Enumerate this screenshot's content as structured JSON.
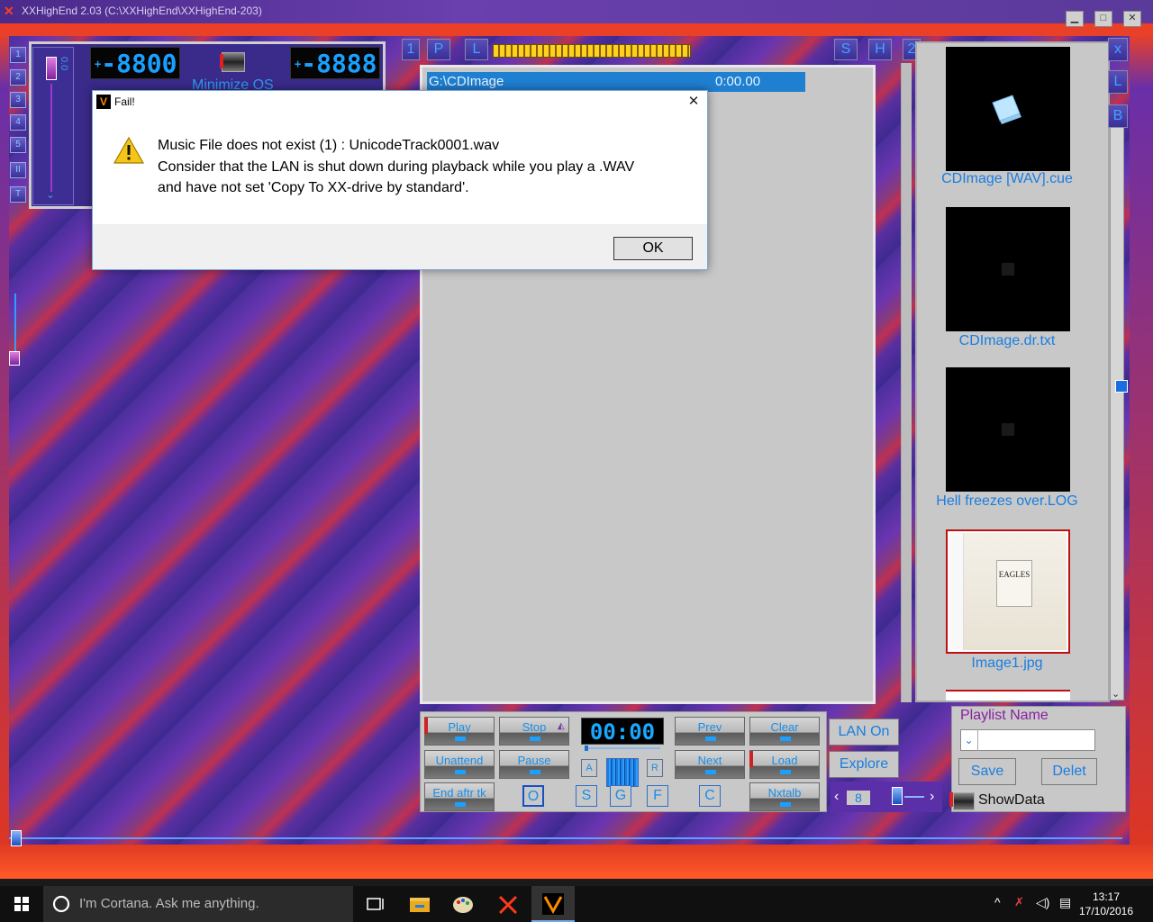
{
  "window": {
    "title": "XXHighEnd 2.03 (C:\\XXHighEnd\\XXHighEnd-203)"
  },
  "left_panel": {
    "number_buttons": [
      "1",
      "2",
      "3",
      "4",
      "5",
      "II",
      "T"
    ],
    "volume_lcd": {
      "sign": "+",
      "digits": "-8800"
    },
    "second_lcd": {
      "sign": "+",
      "digits": "-8888"
    },
    "minimize_os_label": "Minimize OS",
    "vol_axis_label": "0.0"
  },
  "top_tabs": {
    "one": "1",
    "p": "P",
    "l": "L",
    "s": "S",
    "h": "H",
    "two": "2"
  },
  "playlist": {
    "rows": [
      {
        "path": "G:\\CDImage",
        "time": "0:00.00"
      }
    ]
  },
  "cover_panel": {
    "side_buttons": [
      "x",
      "L",
      "B"
    ],
    "items": [
      {
        "caption": "CDImage [WAV].cue",
        "icon": "cd-case-icon"
      },
      {
        "caption": "CDImage.dr.txt",
        "icon": "blank-icon"
      },
      {
        "caption": "Hell freezes over.LOG",
        "icon": "blank-icon"
      },
      {
        "caption": "Image1.jpg",
        "icon": "album-cover"
      }
    ],
    "album_cover_text": "EAGLES"
  },
  "transport": {
    "play": "Play",
    "stop": "Stop",
    "prev": "Prev",
    "clear": "Clear",
    "unattend": "Unattend",
    "pause": "Pause",
    "next": "Next",
    "load": "Load",
    "end_after_track": "End aftr tk",
    "nxtalb": "Nxtalb",
    "time_display": "00:00",
    "letter_o": "O",
    "letter_s": "S",
    "letter_g": "G",
    "letter_f": "F",
    "letter_c": "C",
    "mini_a": "A",
    "mini_r": "R"
  },
  "lan": {
    "lan_on": "LAN On",
    "explore": "Explore"
  },
  "playlist_box": {
    "label": "Playlist Name",
    "value": "",
    "save": "Save",
    "delete": "Delet"
  },
  "nav": {
    "page_number": "8"
  },
  "showdata_label": "ShowData",
  "dialog": {
    "title": "Fail!",
    "line1": "Music File does not exist (1) : UnicodeTrack0001.wav",
    "line2": "Consider that the LAN is shut down during playback while you play a .WAV",
    "line3": "and have not set 'Copy To XX-drive by standard'.",
    "ok_label": "OK"
  },
  "taskbar": {
    "cortana_placeholder": "I'm Cortana. Ask me anything.",
    "time": "13:17",
    "date": "17/10/2016"
  },
  "colors": {
    "accent_blue": "#1a8ee8",
    "selection_blue": "#1f7fd0",
    "frame_red": "#e2371e",
    "stripe_purple": "#5a2fa0"
  }
}
